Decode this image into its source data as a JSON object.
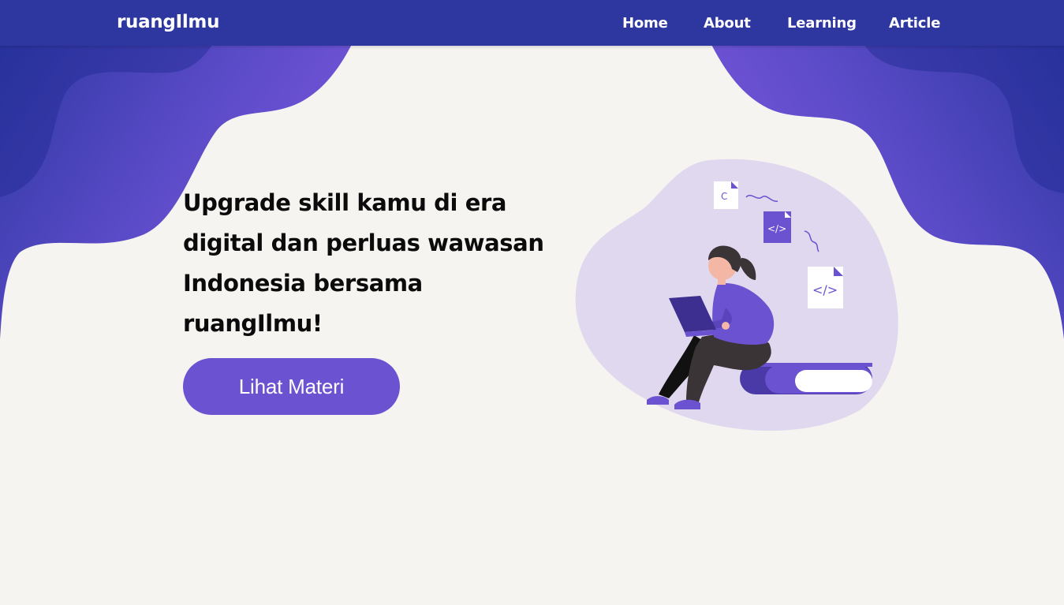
{
  "brand": "ruangIlmu",
  "nav": [
    {
      "label": "Home"
    },
    {
      "label": "About"
    },
    {
      "label": "Learning"
    },
    {
      "label": "Article"
    }
  ],
  "hero": {
    "headline": "Upgrade skill kamu di era digital dan perluas wawasan Indonesia bersama ruangIlmu!",
    "cta_label": "Lihat Materi"
  },
  "illustration": {
    "subject": "woman-with-laptop-sitting-on-book",
    "file_labels": [
      "</>",
      "</>"
    ]
  },
  "colors": {
    "navbar": "#2e37a0",
    "accent": "#6b52d0",
    "background": "#f5f4f1",
    "blob_dark": "#2b35a0",
    "blob_light": "#7b58da",
    "illustration_bg": "#dfd8ee"
  }
}
